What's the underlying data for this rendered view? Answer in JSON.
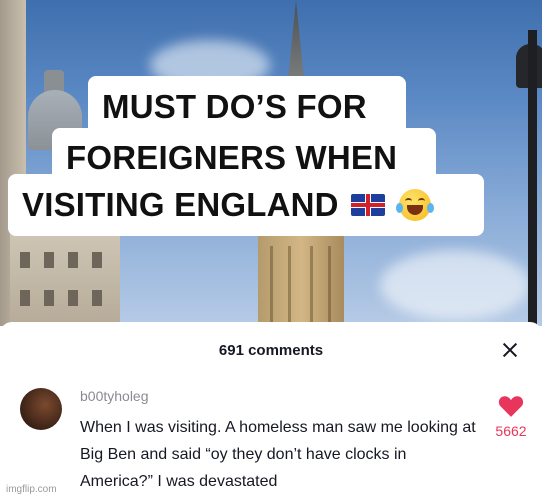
{
  "video": {
    "caption_lines": [
      "MUST DO’S FOR",
      "FOREIGNERS WHEN",
      "VISITING  ENGLAND"
    ],
    "flag_icon": "uk-flag-icon",
    "emoji_icon": "tears-of-joy-emoji"
  },
  "comments": {
    "title": "691 comments",
    "close_icon": "close-icon",
    "items": [
      {
        "username": "b00tyholeg",
        "text": "When I was visiting. A homeless man saw me looking at Big Ben and said “oy they don’t have clocks in America?” I was devastated",
        "like_count": "5662",
        "like_color": "#e8355b"
      }
    ]
  },
  "watermark": "imgflip.com"
}
